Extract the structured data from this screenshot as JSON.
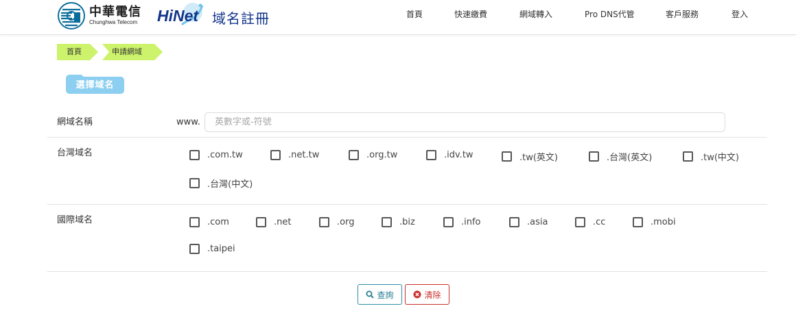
{
  "brand": {
    "cht_name_zh": "中華電信",
    "cht_name_en": "Chunghwa Telecom",
    "hinet_word": "HiNet",
    "hinet_sub": "域名註冊"
  },
  "nav": {
    "items": [
      "首頁",
      "快速繳費",
      "網域轉入",
      "Pro DNS代管",
      "客戶服務",
      "登入"
    ]
  },
  "breadcrumb": [
    "首頁",
    "申請網域"
  ],
  "section": {
    "title": "選擇域名"
  },
  "form": {
    "domain_name": {
      "label": "網域名稱",
      "prefix": "www.",
      "value": "",
      "placeholder": "英數字或-符號"
    },
    "tw_domains": {
      "label": "台灣域名",
      "options": [
        ".com.tw",
        ".net.tw",
        ".org.tw",
        ".idv.tw",
        ".tw(英文)",
        ".台灣(英文)",
        ".tw(中文)",
        ".台灣(中文)"
      ]
    },
    "intl_domains": {
      "label": "國際域名",
      "options": [
        ".com",
        ".net",
        ".org",
        ".biz",
        ".info",
        ".asia",
        ".cc",
        ".mobi",
        ".taipei"
      ]
    }
  },
  "buttons": {
    "search": "查詢",
    "clear": "清除"
  },
  "colors": {
    "breadcrumb_bg": "#ccf36b",
    "section_tag_bg": "#8ccff0",
    "brand_blue": "#12358a",
    "search_button": "#2f8fa6",
    "clear_button": "#c9302c"
  }
}
